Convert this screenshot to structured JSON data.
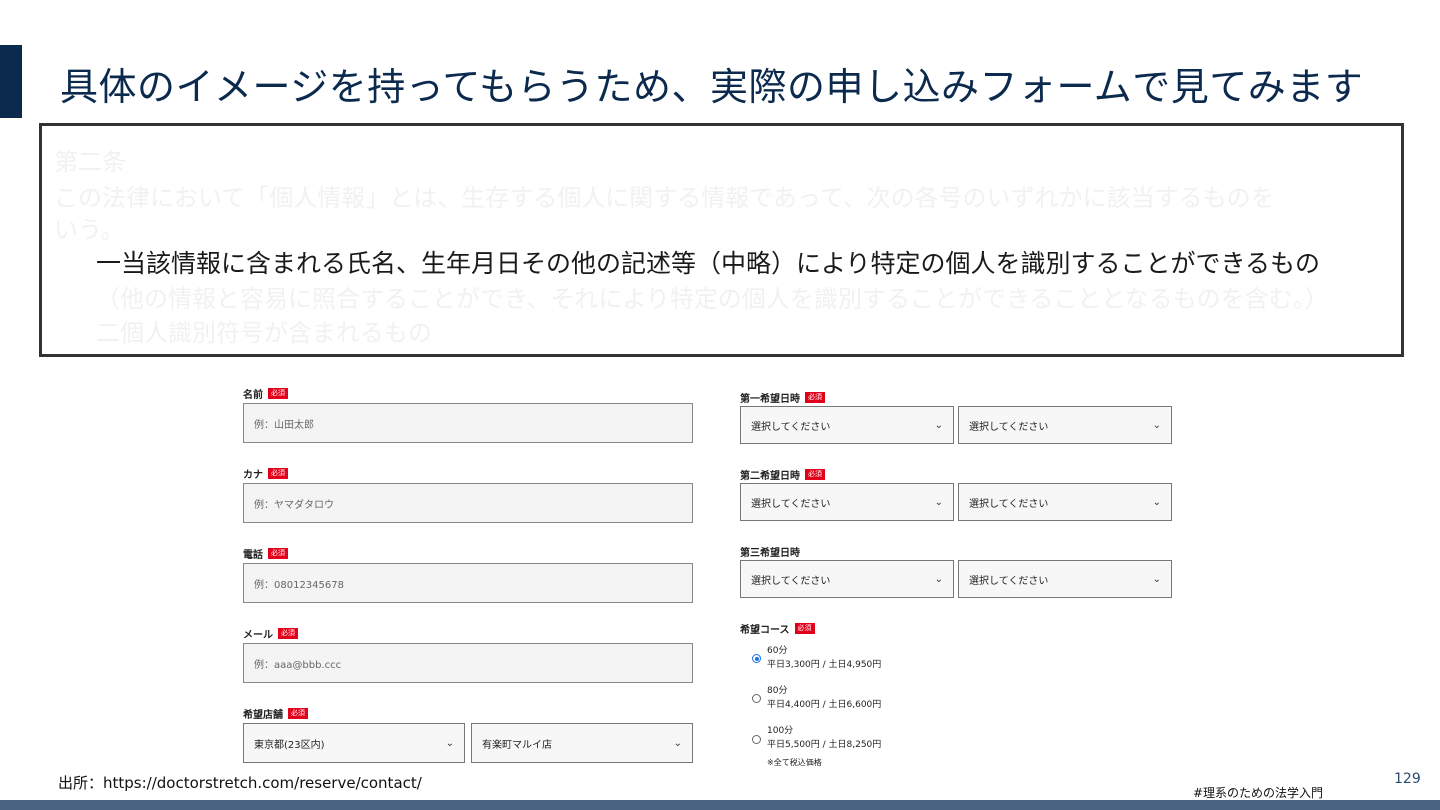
{
  "slide": {
    "title": "具体のイメージを持ってもらうため、実際の申し込みフォームで見てみます",
    "page_number": "129",
    "source": "出所：https://doctorstretch.com/reserve/contact/",
    "hashtag": "#理系のための法学入門"
  },
  "law": {
    "heading": "第二条",
    "para1": "この法律において「個人情報」とは、生存する個人に関する情報であって、次の各号のいずれかに該当するものを",
    "para2": "いう。",
    "item1": "一当該情報に含まれる氏名、生年月日その他の記述等（中略）により特定の個人を識別することができるもの",
    "item1_cont": "（他の情報と容易に照合することができ、それにより特定の個人を識別することができることとなるものを含む。）",
    "item2": "二個人識別符号が含まれるもの"
  },
  "form": {
    "required_badge": "必須",
    "name": {
      "label": "名前",
      "placeholder": "例：山田太郎"
    },
    "kana": {
      "label": "カナ",
      "placeholder": "例：ヤマダタロウ"
    },
    "phone": {
      "label": "電話",
      "placeholder": "例：08012345678"
    },
    "email": {
      "label": "メール",
      "placeholder": "例：aaa@bbb.ccc"
    },
    "store": {
      "label": "希望店舗",
      "area": "東京都(23区内)",
      "shop": "有楽町マルイ店"
    },
    "date1": {
      "label": "第一希望日時",
      "date": "選択してください",
      "time": "選択してください"
    },
    "date2": {
      "label": "第二希望日時",
      "date": "選択してください",
      "time": "選択してください"
    },
    "date3": {
      "label": "第三希望日時",
      "date": "選択してください",
      "time": "選択してください"
    },
    "course": {
      "label": "希望コース",
      "options": [
        {
          "title": "60分",
          "price": "平日3,300円 / 土日4,950円",
          "selected": true
        },
        {
          "title": "80分",
          "price": "平日4,400円 / 土日6,600円",
          "selected": false
        },
        {
          "title": "100分",
          "price": "平日5,500円 / 土日8,250円",
          "selected": false
        }
      ],
      "note": "※全て税込価格"
    }
  }
}
